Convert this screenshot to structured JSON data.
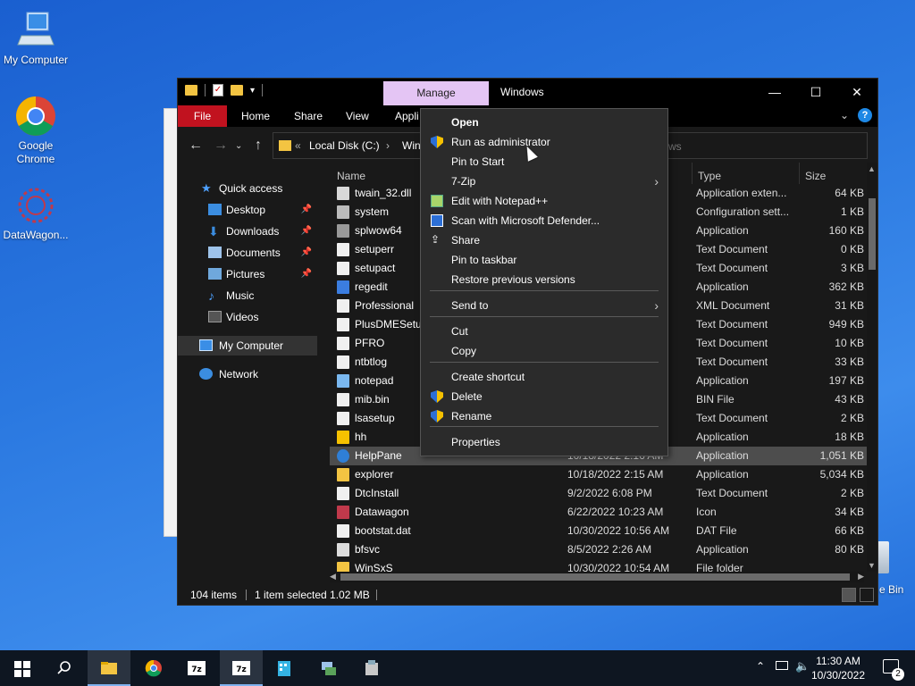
{
  "desktop": {
    "icons": [
      {
        "label": "My Computer",
        "icon": "computer-icon"
      },
      {
        "label": "Google Chrome",
        "icon": "chrome-icon"
      },
      {
        "label": "DataWagon...",
        "icon": "datawagon-icon"
      }
    ],
    "recycle_bin_label": "e Bin"
  },
  "explorer": {
    "contextual_tab": "Manage",
    "title": "Windows",
    "window_buttons": {
      "minimize": "—",
      "maximize": "☐",
      "close": "✕"
    },
    "ribbon_tabs": [
      "File",
      "Home",
      "Share",
      "View",
      "Appli"
    ],
    "address": {
      "chevron": "«",
      "part1": "Local Disk (C:)",
      "arrow": "›",
      "part2": "Wind"
    },
    "search_placeholder": "ws",
    "nav": {
      "quick_access": "Quick access",
      "items": [
        "Desktop",
        "Downloads",
        "Documents",
        "Pictures",
        "Music",
        "Videos"
      ],
      "my_computer": "My Computer",
      "network": "Network"
    },
    "columns": {
      "name": "Name",
      "type": "Type",
      "size": "Size"
    },
    "rows": [
      {
        "name": "twain_32.dll",
        "date": "",
        "type": "Application exten...",
        "size": "64 KB",
        "icon": "dll"
      },
      {
        "name": "system",
        "date": "",
        "type": "Configuration sett...",
        "size": "1 KB",
        "icon": "config"
      },
      {
        "name": "splwow64",
        "date": "",
        "type": "Application",
        "size": "160 KB",
        "icon": "printer"
      },
      {
        "name": "setuperr",
        "date": "",
        "type": "Text Document",
        "size": "0 KB",
        "icon": "text"
      },
      {
        "name": "setupact",
        "date": "",
        "type": "Text Document",
        "size": "3 KB",
        "icon": "text"
      },
      {
        "name": "regedit",
        "date": "",
        "type": "Application",
        "size": "362 KB",
        "icon": "regedit"
      },
      {
        "name": "Professional",
        "date": "",
        "type": "XML Document",
        "size": "31 KB",
        "icon": "text"
      },
      {
        "name": "PlusDMESetup",
        "date": "",
        "type": "Text Document",
        "size": "949 KB",
        "icon": "text"
      },
      {
        "name": "PFRO",
        "date": "",
        "type": "Text Document",
        "size": "10 KB",
        "icon": "text"
      },
      {
        "name": "ntbtlog",
        "date": "",
        "type": "Text Document",
        "size": "33 KB",
        "icon": "text"
      },
      {
        "name": "notepad",
        "date": "",
        "type": "Application",
        "size": "197 KB",
        "icon": "notepad"
      },
      {
        "name": "mib.bin",
        "date": "",
        "type": "BIN File",
        "size": "43 KB",
        "icon": "text"
      },
      {
        "name": "lsasetup",
        "date": "",
        "type": "Text Document",
        "size": "2 KB",
        "icon": "text"
      },
      {
        "name": "hh",
        "date": "",
        "type": "Application",
        "size": "18 KB",
        "icon": "help"
      },
      {
        "name": "HelpPane",
        "date": "10/18/2022 2:16 AM",
        "type": "Application",
        "size": "1,051 KB",
        "icon": "helppane"
      },
      {
        "name": "explorer",
        "date": "10/18/2022 2:15 AM",
        "type": "Application",
        "size": "5,034 KB",
        "icon": "folder"
      },
      {
        "name": "DtcInstall",
        "date": "9/2/2022 6:08 PM",
        "type": "Text Document",
        "size": "2 KB",
        "icon": "text"
      },
      {
        "name": "Datawagon",
        "date": "6/22/2022 10:23 AM",
        "type": "Icon",
        "size": "34 KB",
        "icon": "datawagon"
      },
      {
        "name": "bootstat.dat",
        "date": "10/30/2022 10:56 AM",
        "type": "DAT File",
        "size": "66 KB",
        "icon": "text"
      },
      {
        "name": "bfsvc",
        "date": "8/5/2022 2:26 AM",
        "type": "Application",
        "size": "80 KB",
        "icon": "app"
      },
      {
        "name": "WinSxS",
        "date": "10/30/2022 10:54 AM",
        "type": "File folder",
        "size": "",
        "icon": "folder"
      }
    ],
    "status": {
      "count": "104 items",
      "selected": "1 item selected  1.02 MB"
    }
  },
  "context_menu": {
    "items": [
      {
        "label": "Open",
        "bold": true,
        "icon": ""
      },
      {
        "label": "Run as administrator",
        "icon": "shield"
      },
      {
        "label": "Pin to Start",
        "icon": ""
      },
      {
        "label": "7-Zip",
        "icon": "",
        "submenu": true
      },
      {
        "label": "Edit with Notepad++",
        "icon": "notepadpp"
      },
      {
        "label": "Scan with Microsoft Defender...",
        "icon": "defender"
      },
      {
        "label": "Share",
        "icon": "share"
      },
      {
        "label": "Pin to taskbar",
        "icon": ""
      },
      {
        "label": "Restore previous versions",
        "icon": ""
      },
      {
        "label": "Send to",
        "icon": "",
        "submenu": true
      },
      {
        "label": "Cut",
        "icon": ""
      },
      {
        "label": "Copy",
        "icon": ""
      },
      {
        "label": "Create shortcut",
        "icon": ""
      },
      {
        "label": "Delete",
        "icon": "shield"
      },
      {
        "label": "Rename",
        "icon": "shield"
      },
      {
        "label": "Properties",
        "icon": ""
      }
    ]
  },
  "taskbar": {
    "time": "11:30 AM",
    "date": "10/30/2022",
    "notification_count": "2",
    "apps": [
      "file-explorer-icon",
      "chrome-icon",
      "7zip-icon",
      "7zip-icon",
      "app-icon",
      "network-app-icon",
      "archive-app-icon"
    ]
  },
  "colors": {
    "accent_file_tab": "#c1121f",
    "manage_tab": "#e4c5f4",
    "selection": "#4d4d4d"
  }
}
